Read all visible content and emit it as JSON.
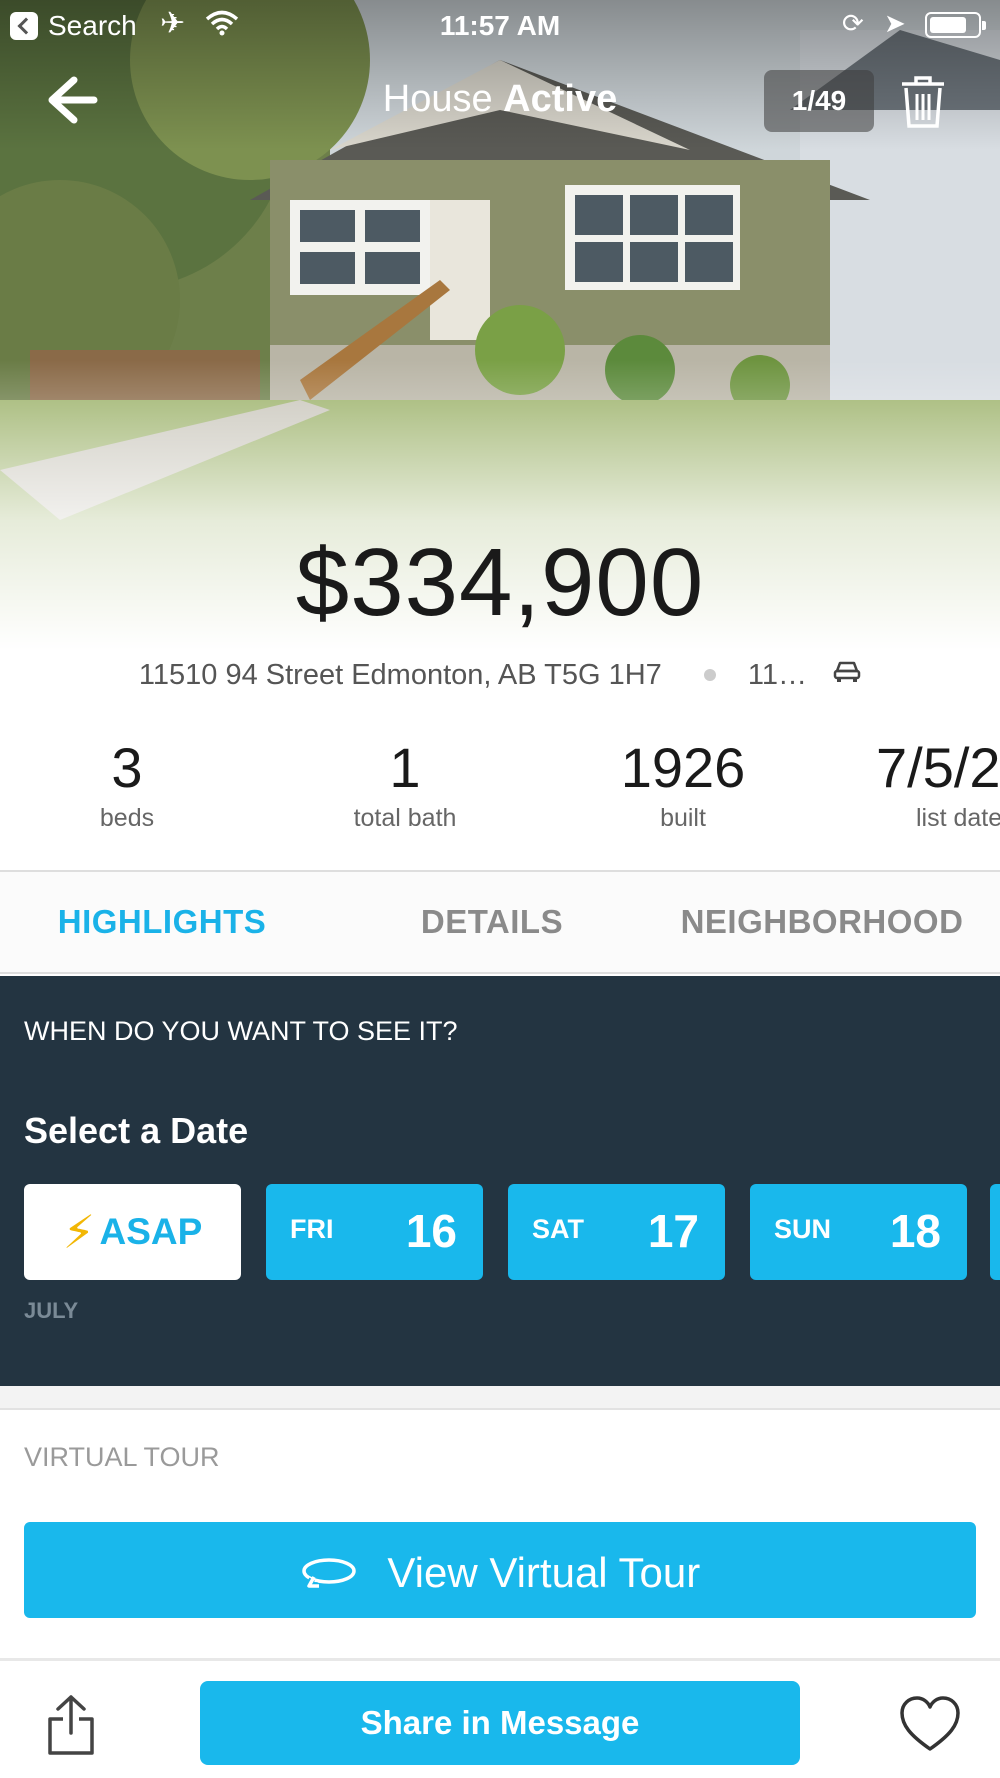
{
  "status_bar": {
    "back_app": "Search",
    "time": "11:57 AM",
    "icons": [
      "airplane-icon",
      "wifi-icon",
      "orientation-lock-icon",
      "location-icon",
      "battery-icon"
    ]
  },
  "nav": {
    "title_prefix": "House",
    "title_status": "Active",
    "counter": "1/49"
  },
  "listing": {
    "price": "$334,900",
    "address": "11510 94 Street Edmonton, AB T5G 1H7",
    "commute": "11…"
  },
  "stats": [
    {
      "value": "3",
      "label": "beds"
    },
    {
      "value": "1",
      "label": "total bath"
    },
    {
      "value": "1926",
      "label": "built"
    },
    {
      "value": "7/5/2",
      "label": "list date"
    }
  ],
  "tabs": [
    {
      "label": "HIGHLIGHTS",
      "active": true
    },
    {
      "label": "DETAILS",
      "active": false
    },
    {
      "label": "NEIGHBORHOOD",
      "active": false
    }
  ],
  "schedule": {
    "question": "WHEN DO YOU WANT TO SEE IT?",
    "heading": "Select a Date",
    "asap_label": "ASAP",
    "dates": [
      {
        "dow": "FRI",
        "day": "16"
      },
      {
        "dow": "SAT",
        "day": "17"
      },
      {
        "dow": "SUN",
        "day": "18"
      }
    ],
    "month": "JULY"
  },
  "virtual_tour": {
    "section_label": "VIRTUAL TOUR",
    "button_label": "View Virtual Tour"
  },
  "bottom_bar": {
    "share_message_label": "Share in Message"
  },
  "colors": {
    "accent": "#19b8ec",
    "tab_active": "#1ab2e8",
    "schedule_bg": "#233441",
    "bolt": "#f2b705"
  }
}
